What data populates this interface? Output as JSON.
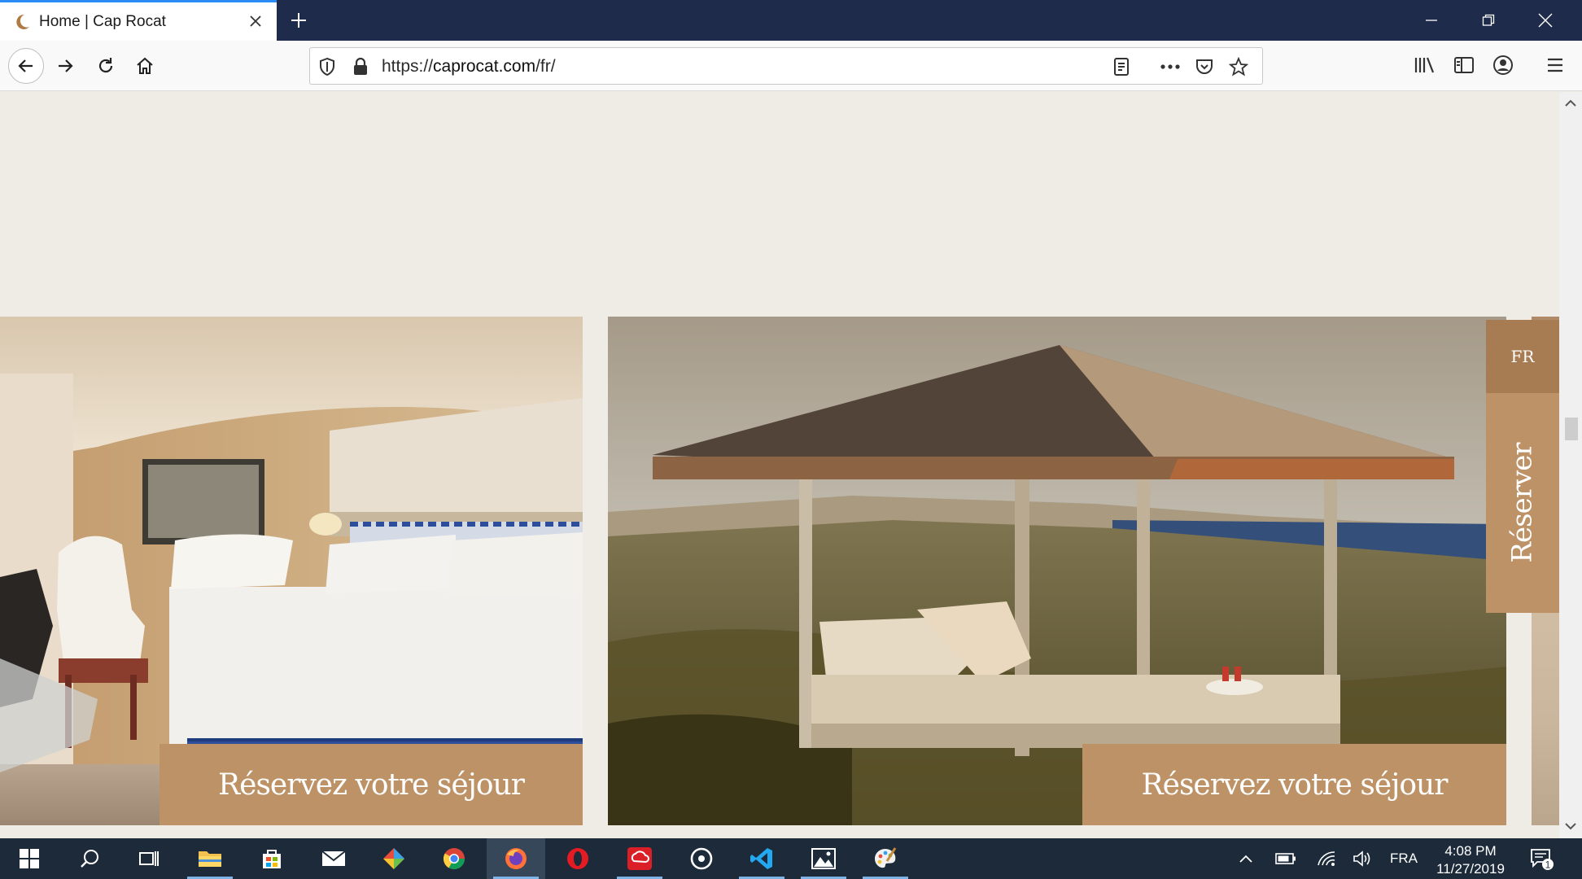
{
  "browser": {
    "tab_title": "Home | Cap Rocat",
    "url_scheme": "https://",
    "url_host": "caprocat.com",
    "url_path": "/fr/"
  },
  "page": {
    "cards": [
      {
        "button_label": "Réservez votre séjour",
        "image": "hotel-bedroom"
      },
      {
        "button_label": "Réservez votre séjour",
        "image": "seaside-pergola-daybed"
      }
    ],
    "side": {
      "lang": "FR",
      "reserve": "Réserver"
    }
  },
  "taskbar": {
    "apps": [
      "start-icon",
      "search-icon",
      "task-view-icon",
      "file-explorer-icon",
      "store-icon",
      "mail-icon",
      "app-icon",
      "chrome-icon",
      "firefox-icon",
      "opera-icon",
      "creative-cloud-icon",
      "media-icon",
      "vscode-icon",
      "photos-icon",
      "paint-icon"
    ],
    "lang": "FRA",
    "time": "4:08 PM",
    "date": "11/27/2019",
    "notifications": "1"
  },
  "colors": {
    "accent": "#bd9266",
    "accent_dark": "#a87c52",
    "page_bg": "#efece6",
    "titlebar": "#1f2b4a"
  }
}
